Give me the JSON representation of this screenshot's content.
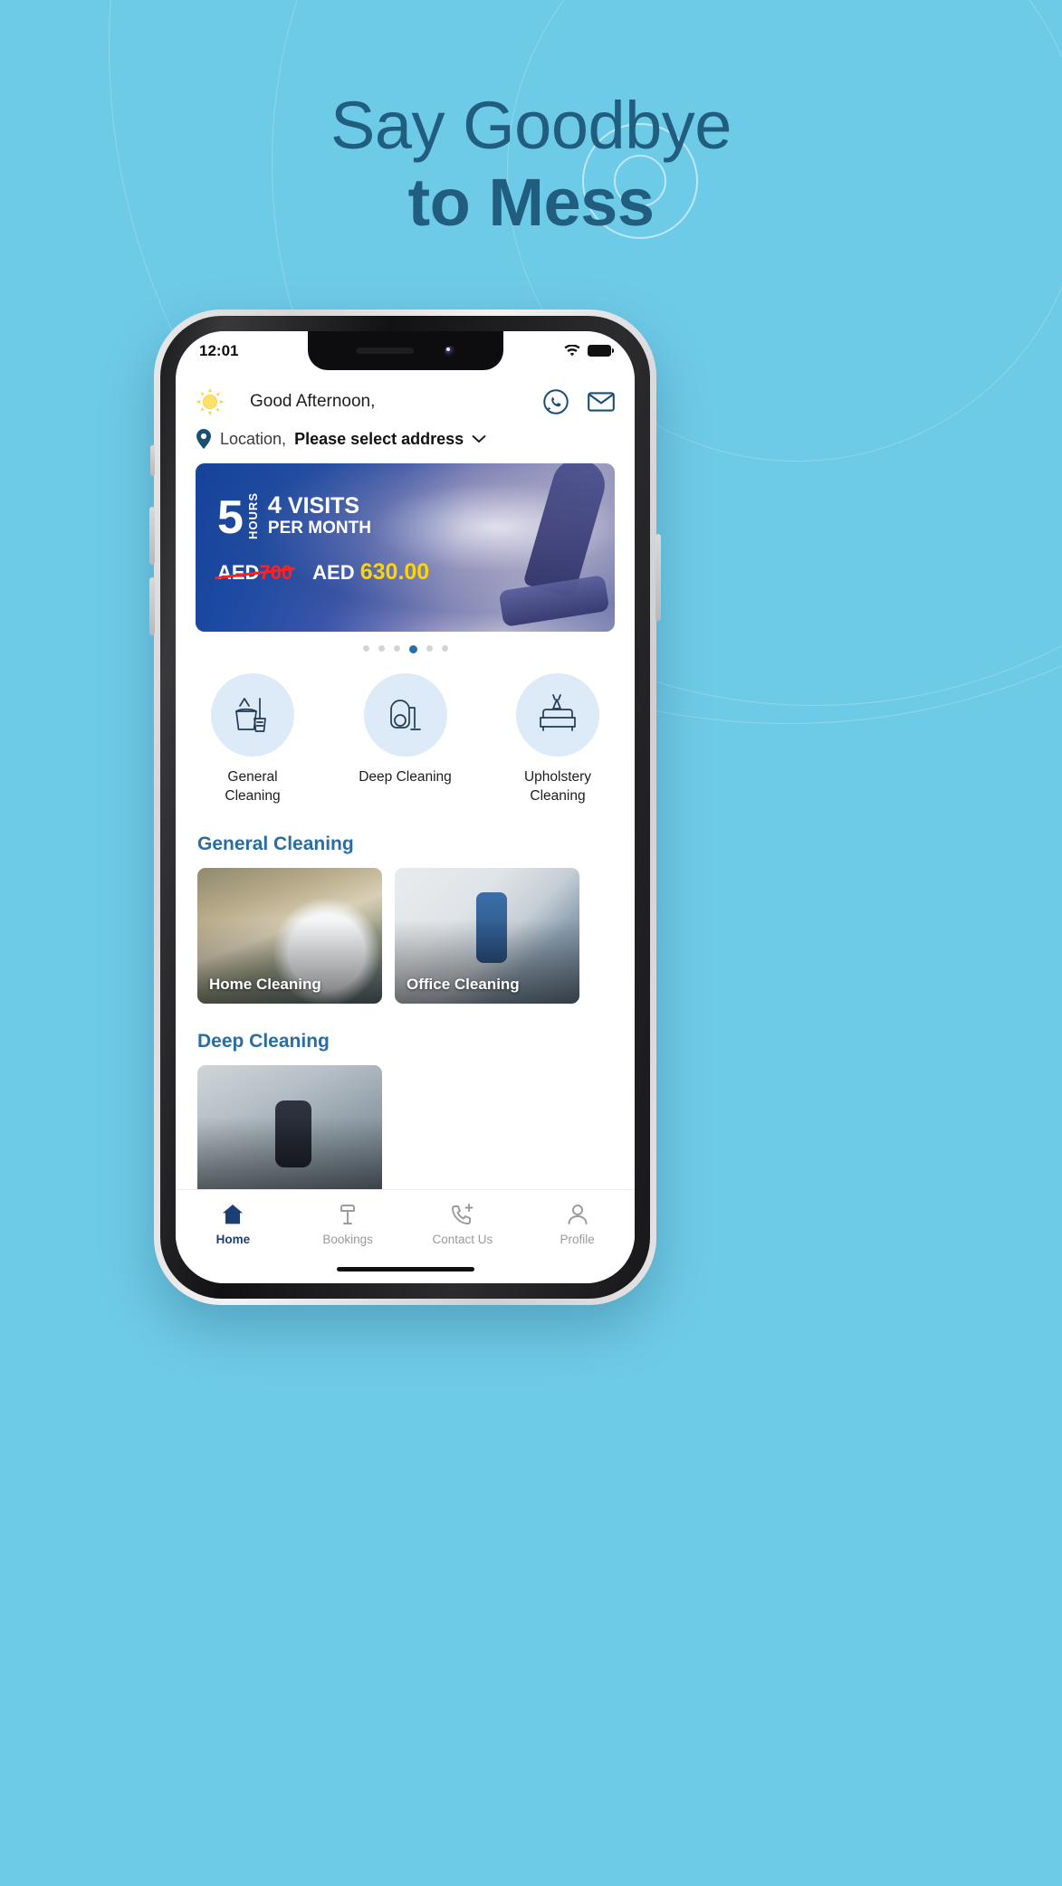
{
  "hero": {
    "line1": "Say Goodbye",
    "line2": "to Mess",
    "color": "#215d7e"
  },
  "background": {
    "color": "#6ecbe8"
  },
  "phone": {
    "status_bar": {
      "time": "12:01",
      "wifi_icon": "wifi-icon",
      "battery_icon": "battery-icon"
    }
  },
  "app": {
    "header": {
      "sun_icon": "sun-icon",
      "greeting": "Good Afternoon,",
      "whatsapp_icon": "whatsapp-icon",
      "mail_icon": "mail-icon"
    },
    "location": {
      "pin_icon": "location-pin-icon",
      "label": "Location,",
      "value": "Please select address",
      "chevron_icon": "chevron-down-icon"
    },
    "banner": {
      "hours_number": "5",
      "hours_word": "HOURS",
      "visits_number": "4",
      "visits_word": "VISITS",
      "per_month": "PER MONTH",
      "old_currency": "AED",
      "old_price": "700",
      "new_currency": "AED",
      "new_price": "630.00",
      "old_price_color": "#ff2020",
      "new_price_color": "#ffd400"
    },
    "carousel": {
      "total": 6,
      "active_index": 3
    },
    "services": [
      {
        "label": "General\nCleaning",
        "icon": "mop-bucket-icon"
      },
      {
        "label": "Deep Cleaning",
        "icon": "vacuum-icon"
      },
      {
        "label": "Upholstery\nCleaning",
        "icon": "sofa-brush-icon"
      }
    ],
    "sections": [
      {
        "title": "General Cleaning",
        "cards": [
          {
            "caption": "Home Cleaning",
            "style": "card-home"
          },
          {
            "caption": "Office Cleaning",
            "style": "card-office"
          }
        ]
      },
      {
        "title": "Deep Cleaning",
        "cards": [
          {
            "caption": "",
            "style": "card-deep"
          }
        ]
      }
    ],
    "tabs": [
      {
        "label": "Home",
        "icon": "home-icon",
        "active": true
      },
      {
        "label": "Bookings",
        "icon": "bookings-icon",
        "active": false
      },
      {
        "label": "Contact Us",
        "icon": "phone-plus-icon",
        "active": false
      },
      {
        "label": "Profile",
        "icon": "person-icon",
        "active": false
      }
    ],
    "accent_color": "#2a6ea0",
    "active_tab_color": "#1b3f72"
  }
}
